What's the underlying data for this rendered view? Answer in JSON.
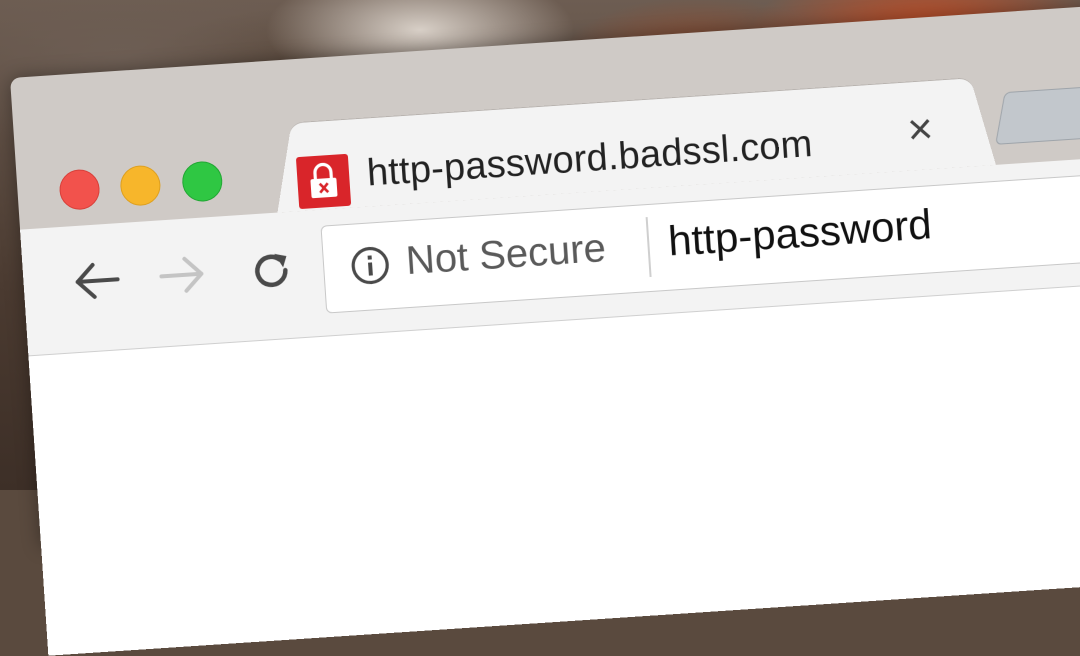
{
  "browser": {
    "traffic_lights": [
      {
        "name": "close",
        "color": "#f2524c"
      },
      {
        "name": "minimize",
        "color": "#f7b62b"
      },
      {
        "name": "maximize",
        "color": "#2fc743"
      }
    ],
    "tab": {
      "title": "http-password.badssl.com",
      "icon": "insecure-lock-icon",
      "icon_color": "#d9252a",
      "close_glyph": "×"
    },
    "toolbar": {
      "back_icon": "arrow-left-icon",
      "forward_icon": "arrow-right-icon",
      "reload_icon": "reload-icon"
    },
    "omnibox": {
      "security_icon": "info-icon",
      "security_label": "Not Secure",
      "url_text": "http-password"
    }
  }
}
